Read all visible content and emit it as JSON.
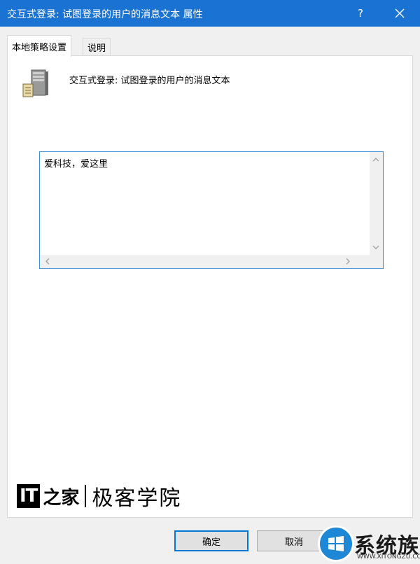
{
  "window": {
    "title": "交互式登录: 试图登录的用户的消息文本 属性",
    "help_label": "?",
    "accent_color": "#1a73d2"
  },
  "tabs": [
    {
      "label": "本地策略设置",
      "active": true
    },
    {
      "label": "说明",
      "active": false
    }
  ],
  "panel": {
    "policy_title": "交互式登录: 试图登录的用户的消息文本",
    "message_value": "爱科技，爱这里"
  },
  "brand": {
    "it": "IT",
    "zhi": "之家",
    "tagline": "极客学院"
  },
  "buttons": {
    "ok": "确定",
    "cancel": "取消"
  },
  "watermark": {
    "brand": "系统族",
    "url": "WWW.XITONGZU.COM"
  }
}
